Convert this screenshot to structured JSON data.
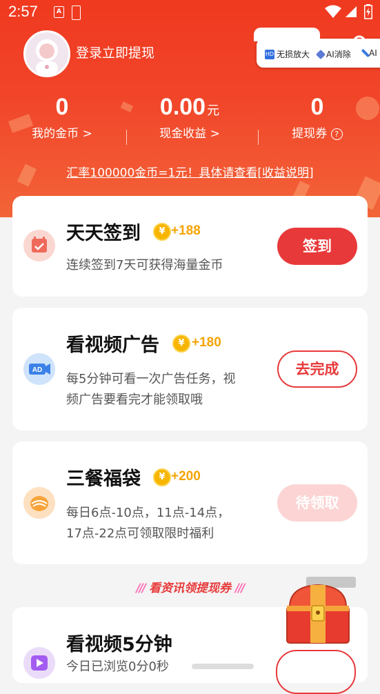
{
  "status_bar": {
    "time": "2:57"
  },
  "header": {
    "login_text": "登录立即提现"
  },
  "tools": [
    {
      "icon": "hd-icon",
      "label": "无损放大"
    },
    {
      "icon": "eraser-icon",
      "label": "AI消除"
    },
    {
      "icon": "brush-icon",
      "label": "AI"
    }
  ],
  "stats": [
    {
      "value": "0",
      "unit": "",
      "label": "我的金币 >"
    },
    {
      "value": "0.00",
      "unit": "元",
      "label": "现金收益 >"
    },
    {
      "value": "0",
      "unit": "",
      "label": "提现券"
    }
  ],
  "rate_text": "汇率100000金币=1元！具体请查看[收益说明]",
  "tasks": [
    {
      "title": "天天签到",
      "bonus": "+188",
      "desc": "连续签到7天可获得海量金币",
      "button": "签到",
      "icon": "calendar-check-icon"
    },
    {
      "title": "看视频广告",
      "bonus": "+180",
      "desc_lines": [
        "每5分钟可看一次广告任务，视",
        "频广告要看完才能领取哦"
      ],
      "button": "去完成",
      "icon": "ad-video-icon"
    },
    {
      "title": "三餐福袋",
      "bonus": "+200",
      "desc_lines": [
        "每日6点-10点，11点-14点，",
        "17点-22点可领取限时福利"
      ],
      "button": "待领取",
      "icon": "meal-bowl-icon"
    }
  ],
  "section_title": "看资讯领提现券",
  "bottom_task": {
    "title": "看视频5分钟",
    "desc": "今日已浏览0分0秒",
    "icon": "play-video-icon"
  },
  "colors": {
    "primary_red": "#e8393a",
    "gold": "#f5a300",
    "hero_top": "#f0391f"
  }
}
